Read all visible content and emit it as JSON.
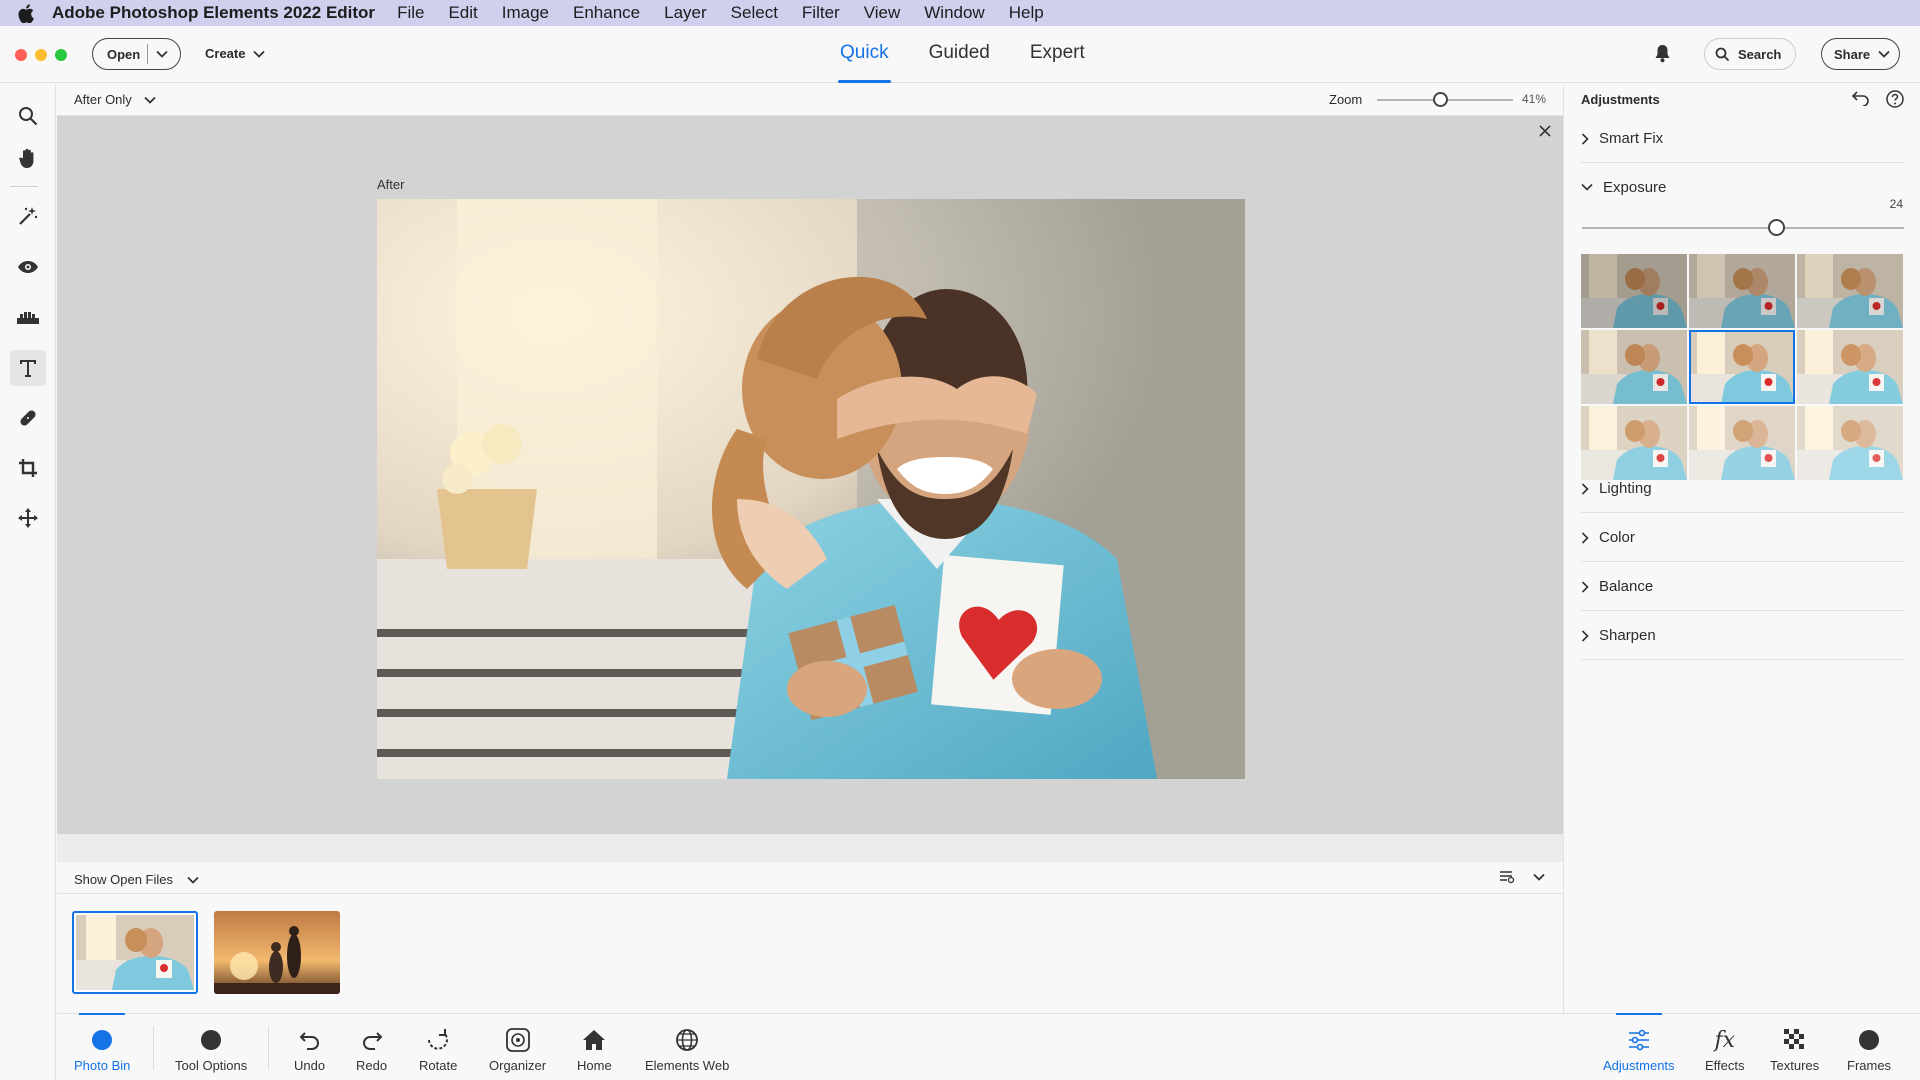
{
  "menubar": {
    "app_name": "Adobe Photoshop Elements 2022 Editor",
    "items": [
      "File",
      "Edit",
      "Image",
      "Enhance",
      "Layer",
      "Select",
      "Filter",
      "View",
      "Window",
      "Help"
    ]
  },
  "header": {
    "open_label": "Open",
    "create_label": "Create",
    "modes": [
      "Quick",
      "Guided",
      "Expert"
    ],
    "active_mode": "Quick",
    "search_label": "Search",
    "share_label": "Share"
  },
  "tools": [
    "zoom-tool",
    "hand-tool",
    "quick-selection-tool",
    "red-eye-tool",
    "whiten-teeth-tool",
    "type-tool",
    "spot-healing-tool",
    "crop-tool",
    "move-tool"
  ],
  "viewbar": {
    "view_option": "After Only",
    "zoom_label": "Zoom",
    "zoom_value": "41%",
    "zoom_fraction": 0.41
  },
  "canvas": {
    "after_label": "After"
  },
  "photo_bin": {
    "show_option": "Show Open Files",
    "thumbnails": [
      "father-daughter-photo",
      "sunset-family-photo"
    ]
  },
  "taskbar": {
    "left": [
      {
        "label": "Photo Bin",
        "icon": "photo-bin-icon"
      },
      {
        "label": "Tool Options",
        "icon": "tool-options-icon"
      },
      {
        "label": "Undo",
        "icon": "undo-icon"
      },
      {
        "label": "Redo",
        "icon": "redo-icon"
      },
      {
        "label": "Rotate",
        "icon": "rotate-icon"
      },
      {
        "label": "Organizer",
        "icon": "organizer-icon"
      },
      {
        "label": "Home",
        "icon": "home-icon"
      },
      {
        "label": "Elements Web",
        "icon": "globe-icon"
      }
    ],
    "right": [
      {
        "label": "Adjustments",
        "icon": "adjustments-icon"
      },
      {
        "label": "Effects",
        "icon": "fx-icon"
      },
      {
        "label": "Textures",
        "icon": "textures-icon"
      },
      {
        "label": "Frames",
        "icon": "frames-icon"
      }
    ]
  },
  "panel": {
    "title": "Adjustments",
    "sections": [
      "Smart Fix",
      "Exposure",
      "Lighting",
      "Color",
      "Balance",
      "Sharpen"
    ],
    "expanded_section": "Exposure",
    "exposure_value": "24",
    "preview_grid_selected": 4
  },
  "colors": {
    "accent": "#1473e6",
    "menubar_bg": "#cfcfee",
    "canvas_bg": "#d3d3d3"
  }
}
